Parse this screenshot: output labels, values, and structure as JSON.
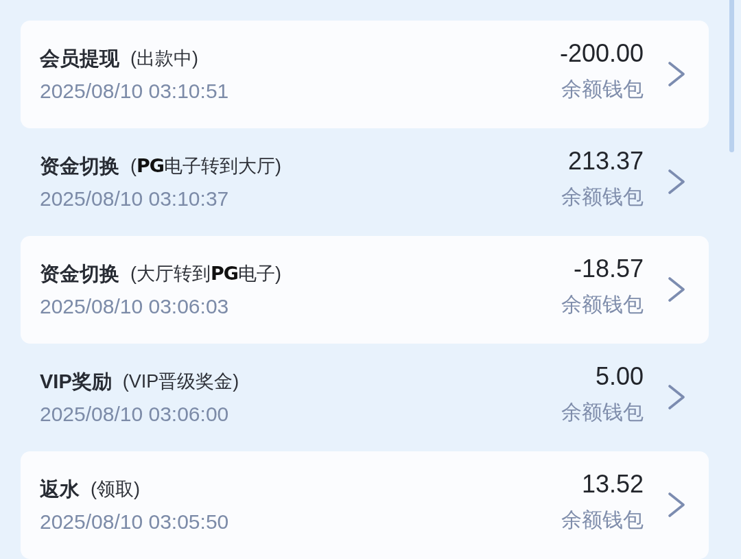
{
  "records": [
    {
      "title": "会员提现",
      "note": "(出款中)",
      "time": "2025/08/10 03:10:51",
      "amount": "-200.00",
      "wallet": "余额钱包"
    },
    {
      "title": "资金切换",
      "note": "(**PG**电子转到大厅)",
      "time": "2025/08/10 03:10:37",
      "amount": "213.37",
      "wallet": "余额钱包"
    },
    {
      "title": "资金切换",
      "note": "(大厅转到**PG**电子)",
      "time": "2025/08/10 03:06:03",
      "amount": "-18.57",
      "wallet": "余额钱包"
    },
    {
      "title": "VIP奖励",
      "note": "(VIP晋级奖金)",
      "time": "2025/08/10 03:06:00",
      "amount": "5.00",
      "wallet": "余额钱包"
    },
    {
      "title": "返水",
      "note": "(领取)",
      "time": "2025/08/10 03:05:50",
      "amount": "13.52",
      "wallet": "余额钱包"
    }
  ]
}
